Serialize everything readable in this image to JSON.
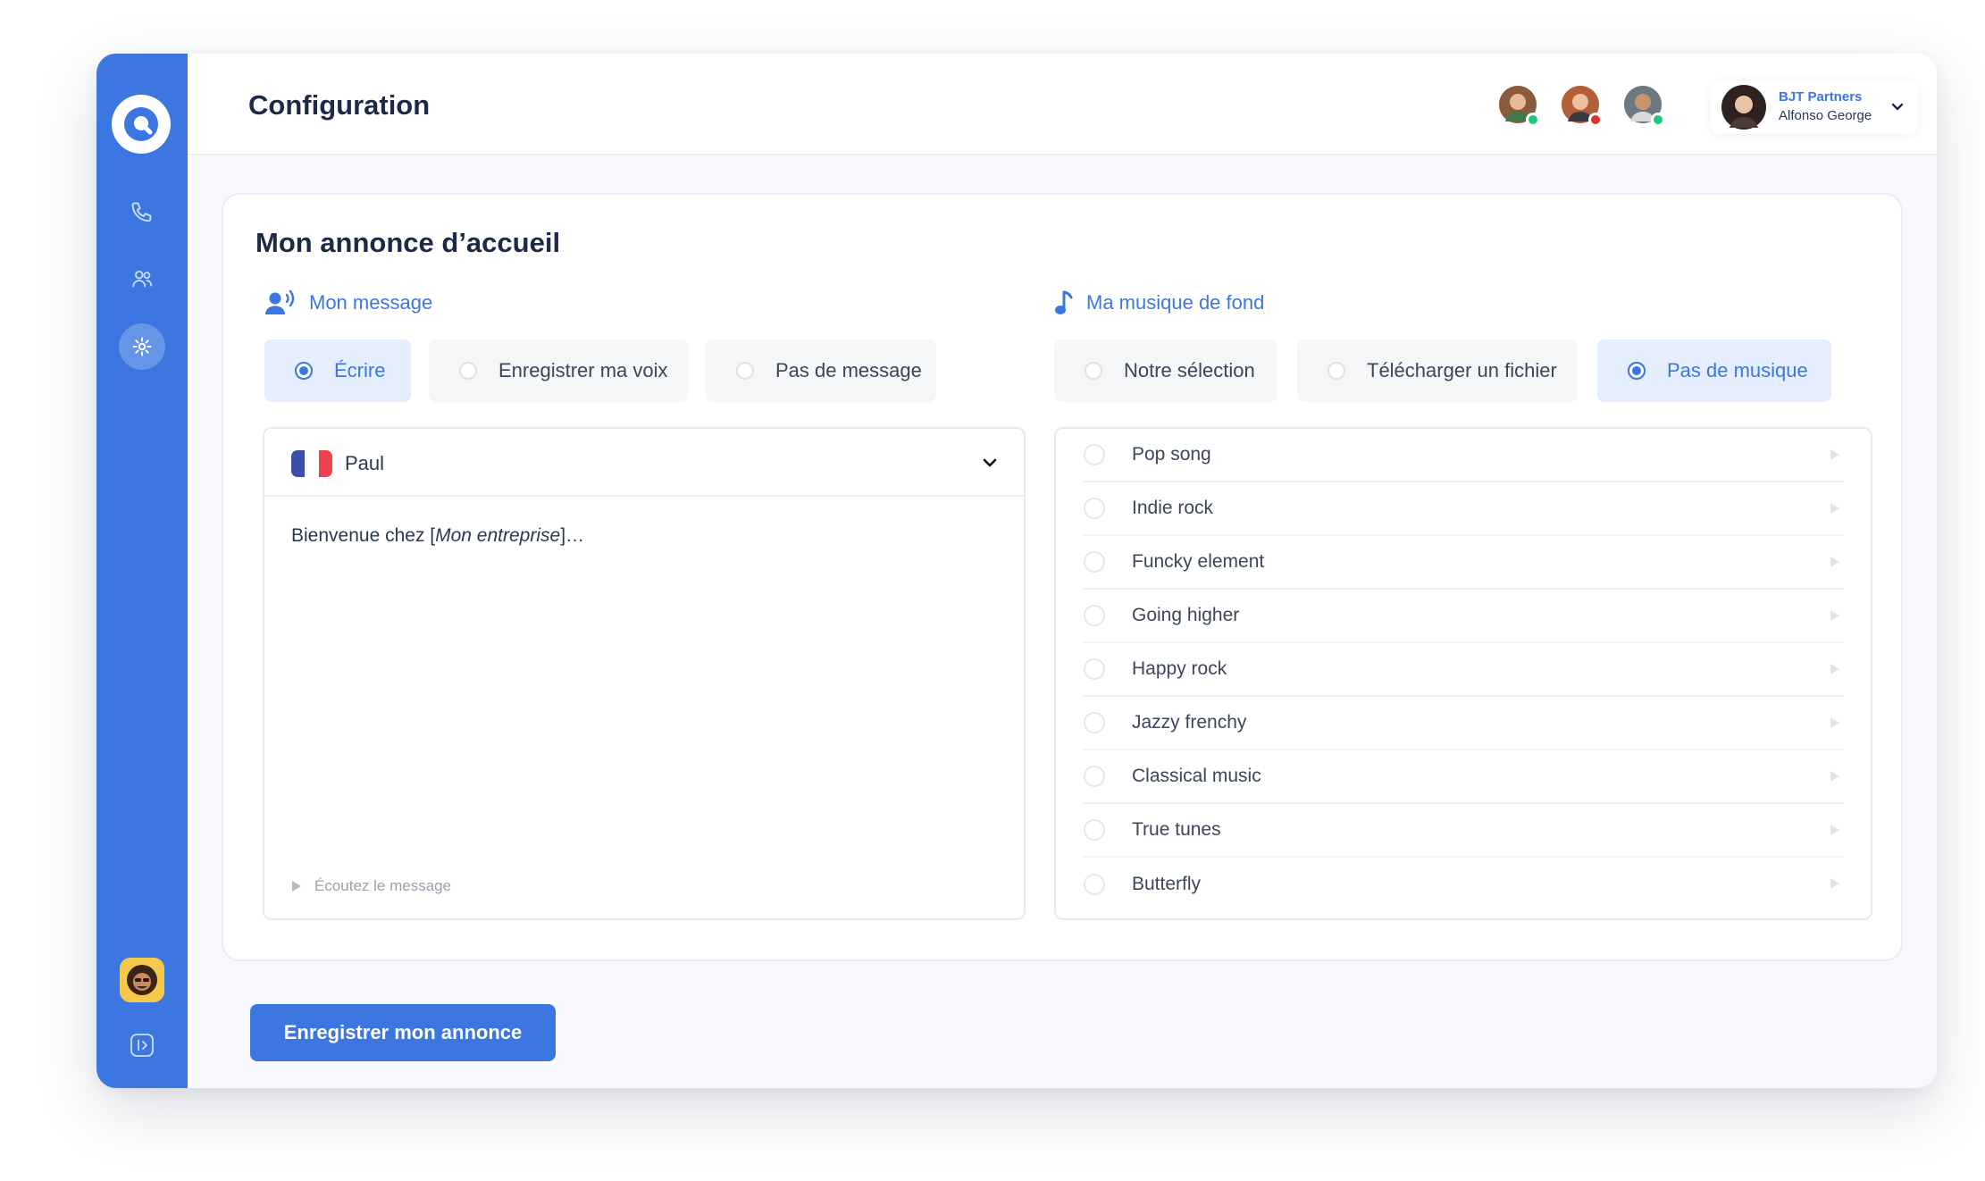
{
  "page": {
    "title": "Configuration"
  },
  "colors": {
    "brand": "#3b76e1",
    "online": "#1ec77a",
    "busy": "#e0322f"
  },
  "sidebar": {
    "items": [
      {
        "icon": "phone-icon"
      },
      {
        "icon": "users-icon"
      },
      {
        "icon": "gear-icon",
        "active": true
      }
    ]
  },
  "header": {
    "team": [
      {
        "status": "online"
      },
      {
        "status": "busy"
      },
      {
        "status": "online"
      }
    ],
    "user": {
      "company": "BJT Partners",
      "name": "Alfonso George"
    }
  },
  "card": {
    "title": "Mon annonce d’accueil",
    "message_section": {
      "label": "Mon message",
      "options": [
        "Écrire",
        "Enregistrer ma voix",
        "Pas de message"
      ],
      "selected": "Écrire",
      "voice": "Paul",
      "text_before": "Bienvenue chez [",
      "text_italic": "Mon entreprise",
      "text_after": "]…",
      "listen_label": "Écoutez le message"
    },
    "music_section": {
      "label": "Ma musique de fond",
      "options": [
        "Notre sélection",
        "Télécharger un fichier",
        "Pas de musique"
      ],
      "selected": "Pas de musique",
      "tracks": [
        "Pop song",
        "Indie rock",
        "Funcky element",
        "Going higher",
        "Happy rock",
        "Jazzy frenchy",
        "Classical music",
        "True tunes",
        "Butterfly"
      ]
    }
  },
  "save_button": {
    "label": "Enregistrer mon annonce"
  }
}
